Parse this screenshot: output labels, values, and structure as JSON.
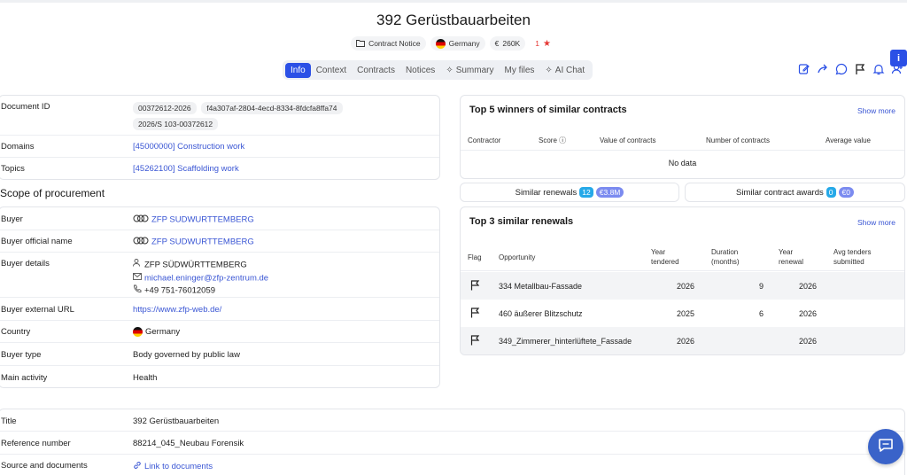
{
  "title": "392 Gerüstbauarbeiten",
  "chips": {
    "notice": "Contract Notice",
    "country": "Germany",
    "value": "260K",
    "currency": "€",
    "rating": "1"
  },
  "tabs": [
    "Info",
    "Context",
    "Contracts",
    "Notices",
    "Summary",
    "My files",
    "AI Chat"
  ],
  "info": {
    "document_id_label": "Document ID",
    "doc_ids": [
      "00372612-2026",
      "f4a307af-2804-4ecd-8334-8fdcfa8ffa74",
      "2026/S 103-00372612"
    ],
    "domains_label": "Domains",
    "domains_value": "[45000000] Construction work",
    "topics_label": "Topics",
    "topics_value": "[45262100] Scaffolding work"
  },
  "scope": {
    "heading": "Scope of procurement",
    "buyer_label": "Buyer",
    "buyer_value": "ZFP SUDWURTTEMBERG",
    "buyer_official_label": "Buyer official name",
    "buyer_official_value": "ZFP SUDWURTTEMBERG",
    "buyer_details_label": "Buyer details",
    "buyer_details_name": "ZFP SÜDWÜRTTEMBERG",
    "buyer_details_email": "michael.eninger@zfp-zentrum.de",
    "buyer_details_phone": "+49 751-76012059",
    "buyer_url_label": "Buyer external URL",
    "buyer_url_value": "https://www.zfp-web.de/",
    "country_label": "Country",
    "country_value": "Germany",
    "buyer_type_label": "Buyer type",
    "buyer_type_value": "Body governed by public law",
    "main_activity_label": "Main activity",
    "main_activity_value": "Health"
  },
  "bottom": {
    "title_label": "Title",
    "title_value": "392 Gerüstbauarbeiten",
    "ref_label": "Reference number",
    "ref_value": "88214_045_Neubau Forensik",
    "source_label": "Source and documents",
    "source_value": "Link to documents"
  },
  "winners": {
    "title": "Top 5 winners of similar contracts",
    "show_more": "Show more",
    "columns": [
      "Contractor",
      "Score",
      "Value of contracts",
      "Number of contracts",
      "Average value"
    ],
    "empty": "No data"
  },
  "similar": {
    "renewals_label": "Similar renewals",
    "renewals_count": "12",
    "renewals_amount": "€3.8M",
    "awards_label": "Similar contract awards",
    "awards_count": "0",
    "awards_amount": "€0"
  },
  "renewals": {
    "title": "Top 3 similar renewals",
    "show_more": "Show more",
    "columns": [
      "Flag",
      "Opportunity",
      "Year tendered",
      "Duration (months)",
      "Year renewal",
      "Avg tenders submitted"
    ],
    "rows": [
      {
        "opportunity": "334 Metallbau-Fassade",
        "year_tendered": "2026",
        "duration": "9",
        "year_renewal": "2026"
      },
      {
        "opportunity": "460 äußerer Blitzschutz",
        "year_tendered": "2025",
        "duration": "6",
        "year_renewal": "2026"
      },
      {
        "opportunity": "349_Zimmerer_hinterlüftete_Fassade",
        "year_tendered": "2026",
        "duration": "",
        "year_renewal": "2026"
      }
    ]
  },
  "colors": {
    "accent": "#2b50e6",
    "link": "#3a56d4",
    "badge_blue": "#26a9e8",
    "badge_violet": "#7b8bf0"
  }
}
